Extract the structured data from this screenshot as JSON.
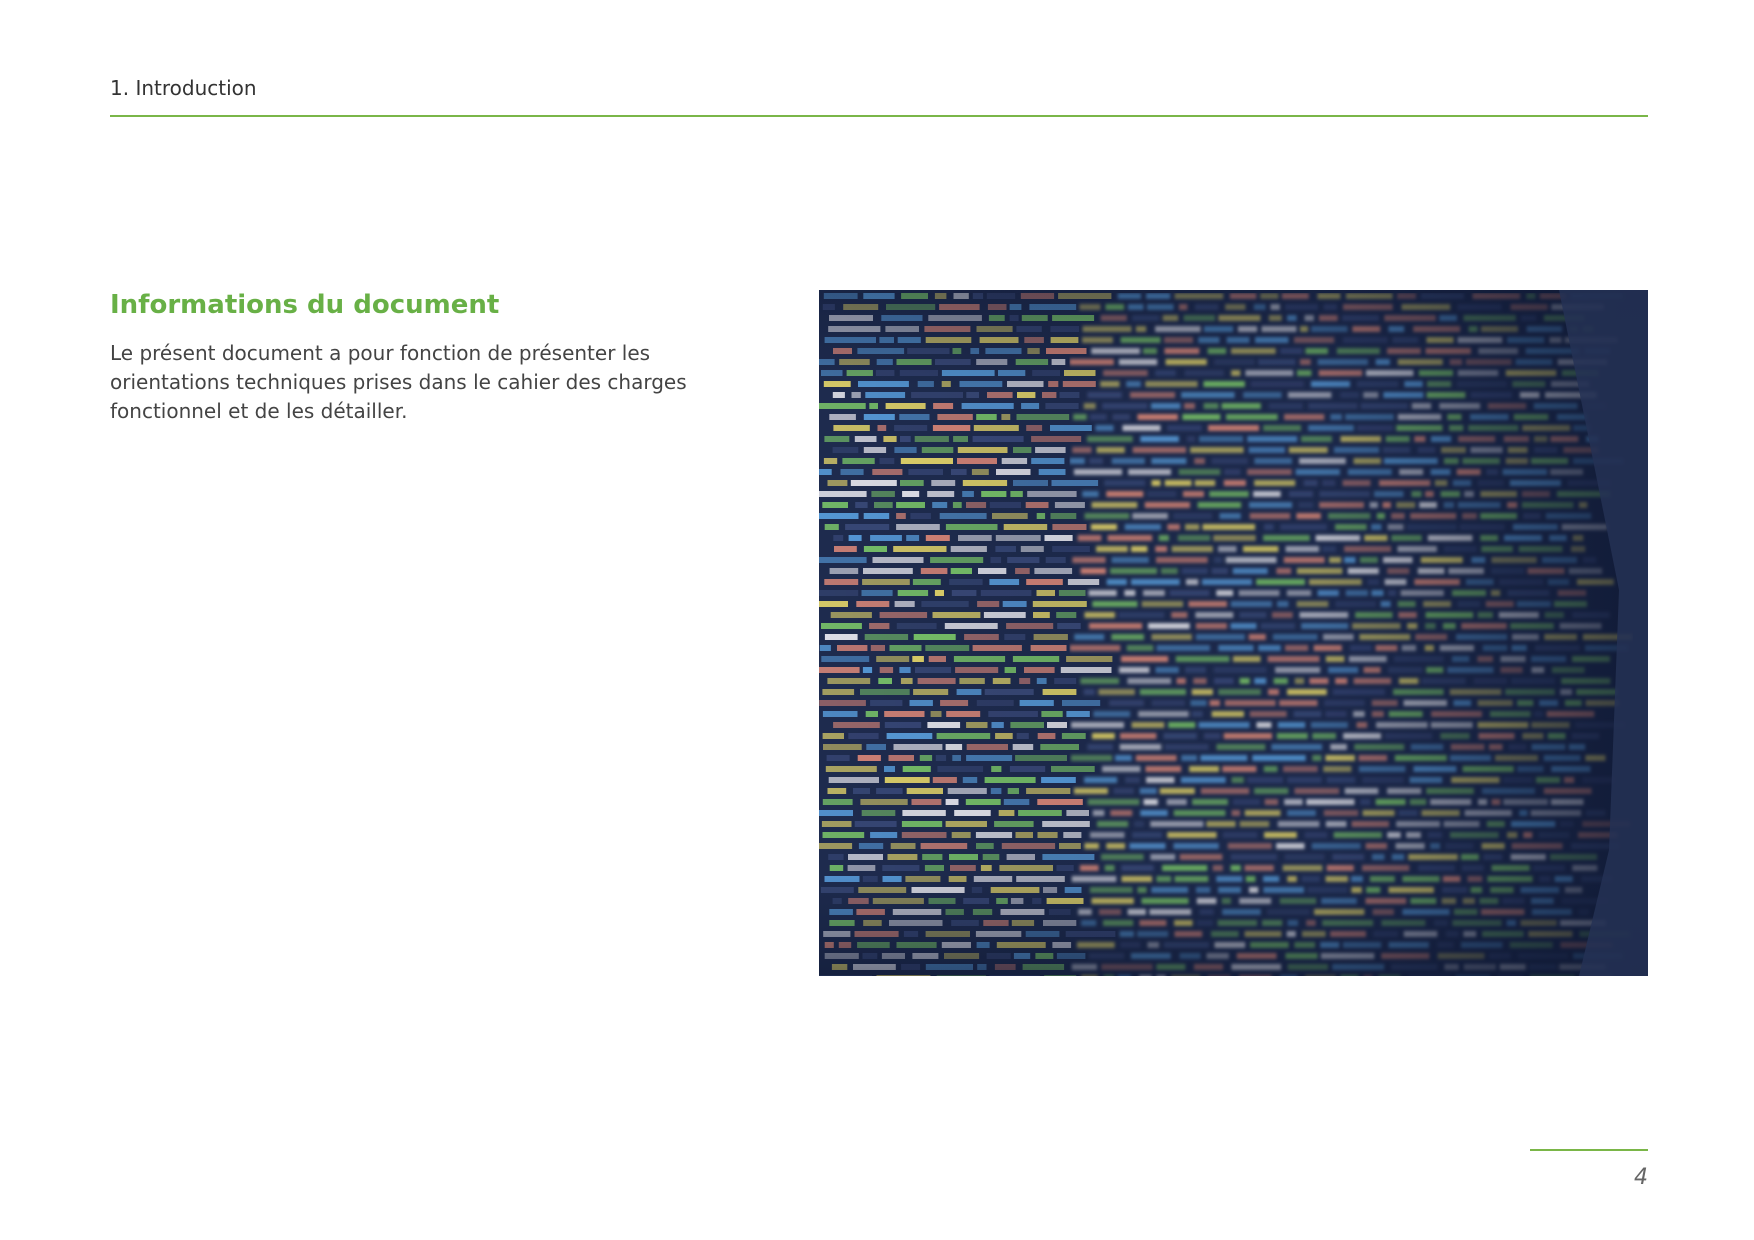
{
  "header": {
    "title": "1. Introduction"
  },
  "section": {
    "heading": "Informations du document",
    "body": "Le présent document a pour fonction de présenter les orientations techniques prises dans le cahier des charges fonctionnel et de les détailler."
  },
  "photo": {
    "subject": "code-screen-photo",
    "palette": [
      "#1e2b4e",
      "#5aa0e0",
      "#7cc96a",
      "#e7d86a",
      "#e9e9f0",
      "#e08a7a",
      "#3a4a7a"
    ]
  },
  "footer": {
    "page_number": "4"
  },
  "colors": {
    "accent": "#7ab648",
    "heading": "#68b046",
    "text": "#444444"
  }
}
